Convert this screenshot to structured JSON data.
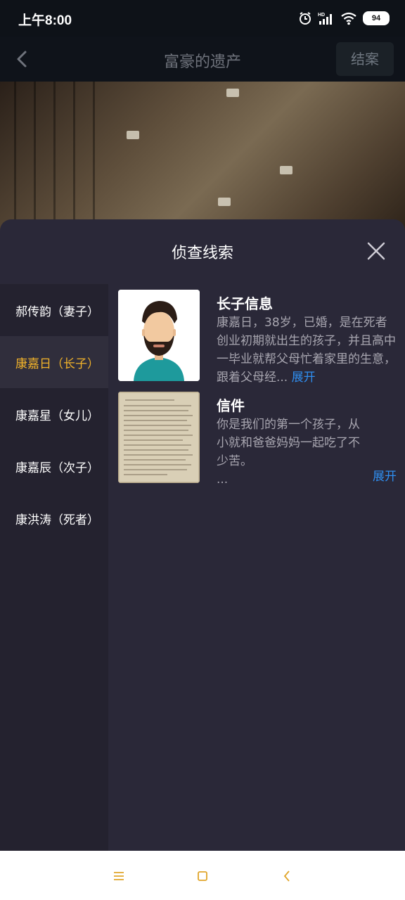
{
  "status_bar": {
    "time": "上午8:00",
    "battery": "94",
    "icons": [
      "alarm-icon",
      "hd-signal-icon",
      "wifi-icon",
      "battery-icon"
    ]
  },
  "top_nav": {
    "title": "富豪的遗产",
    "close_case_label": "结案"
  },
  "sheet": {
    "title": "侦查线索",
    "sidebar": [
      {
        "label": "郝传韵（妻子）",
        "active": false
      },
      {
        "label": "康嘉日（长子）",
        "active": true
      },
      {
        "label": "康嘉星（女儿）",
        "active": false
      },
      {
        "label": "康嘉辰（次子）",
        "active": false
      },
      {
        "label": "康洪涛（死者）",
        "active": false
      }
    ],
    "clues": [
      {
        "title": "长子信息",
        "text": "康嘉日，38岁，已婚，是在死者创业初期就出生的孩子，并且高中一毕业就帮父母忙着家里的生意，跟着父母经...",
        "expand_label": "展开"
      },
      {
        "title": "信件",
        "text": "你是我们的第一个孩子，从小就和爸爸妈妈一起吃了不少苦。\n...",
        "expand_label": "展开"
      }
    ]
  },
  "colors": {
    "accent": "#f2b32a",
    "link": "#2f8ef0",
    "sheet_bg": "#2a2838",
    "sidebar_bg": "#24222f"
  }
}
